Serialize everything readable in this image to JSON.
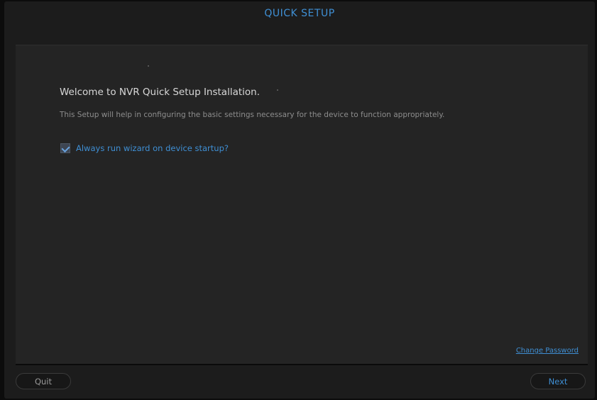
{
  "header": {
    "title": "QUICK SETUP"
  },
  "main": {
    "welcome": "Welcome to NVR  Quick Setup Installation.",
    "description": "This Setup will help in configuring the basic settings necessary for the device to function appropriately.",
    "wizard_checkbox": {
      "label": "Always run wizard on device startup?",
      "checked": true
    },
    "change_password": "Change Password"
  },
  "footer": {
    "quit_label": "Quit",
    "next_label": "Next"
  },
  "colors": {
    "accent": "#3f8fd4",
    "background": "#1c1c1c",
    "panel": "#242424"
  }
}
